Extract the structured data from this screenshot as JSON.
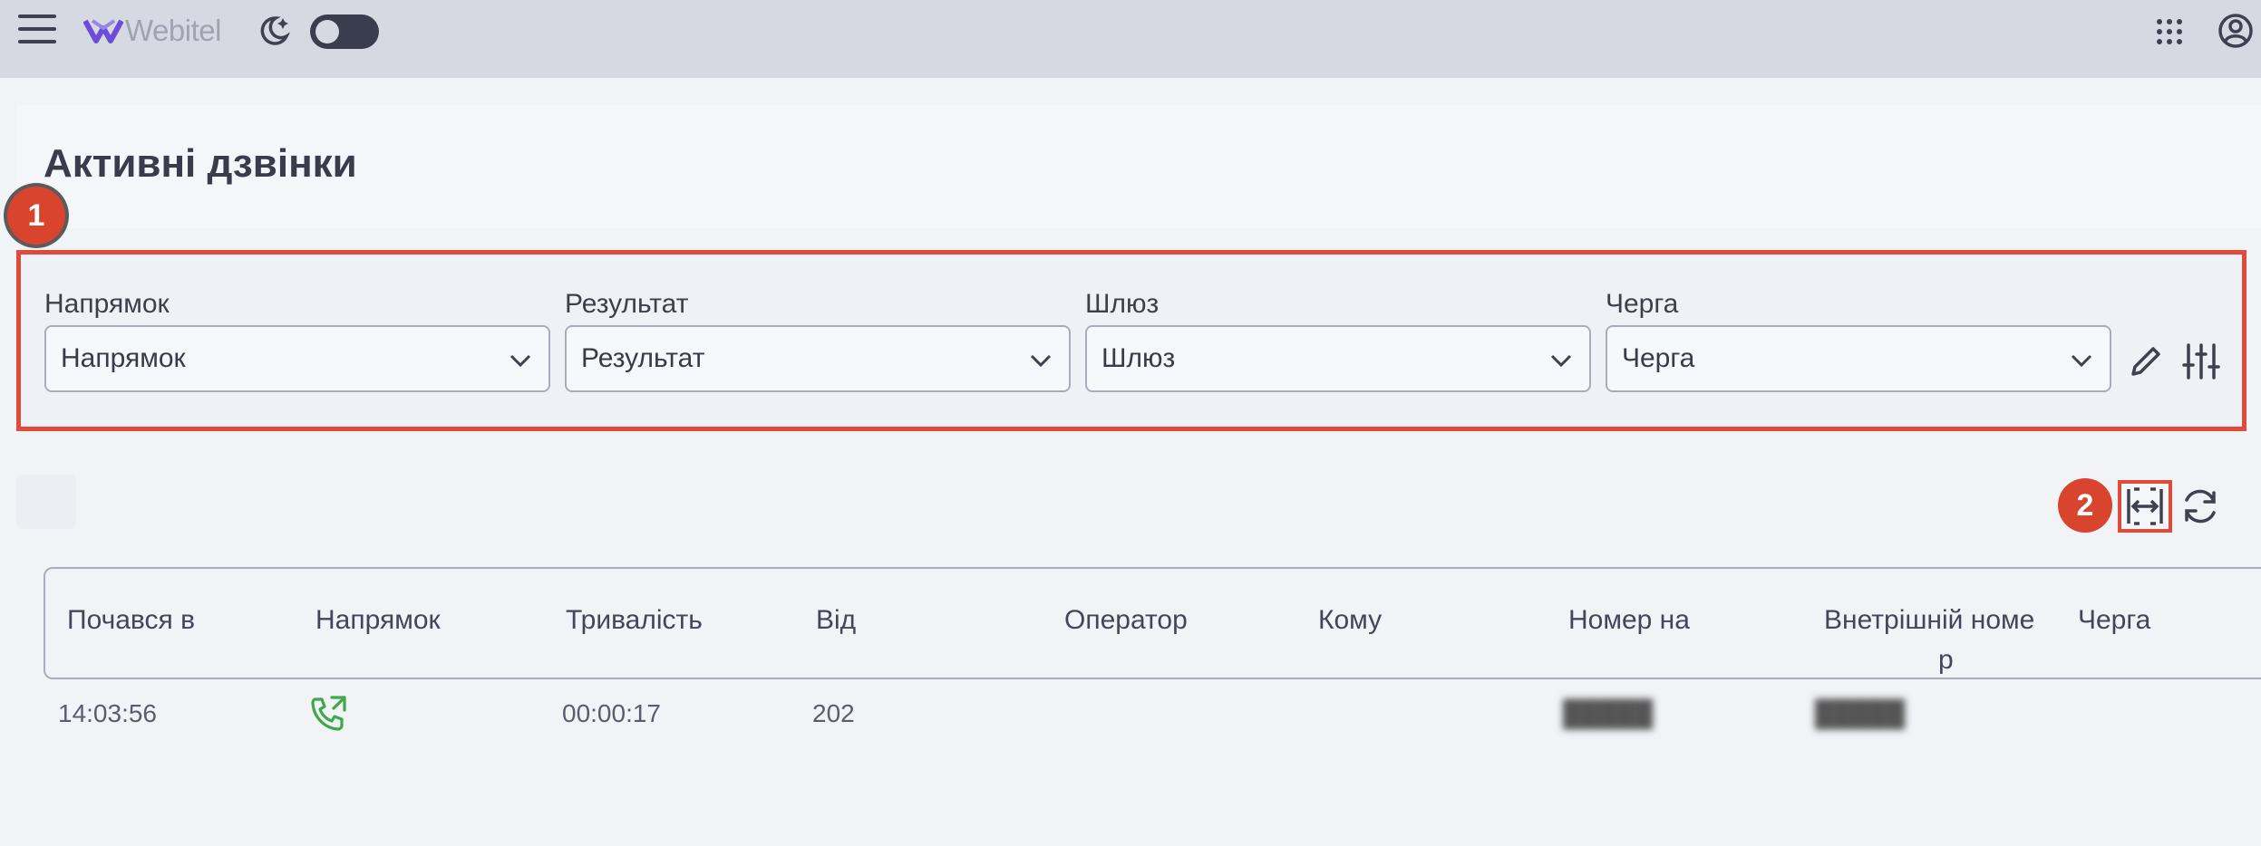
{
  "header": {
    "logo_text": "Webitel",
    "theme_toggle_state": "off"
  },
  "page": {
    "title": "Активні дзвінки"
  },
  "annotations": {
    "badge_1": "1",
    "badge_2": "2"
  },
  "filters": [
    {
      "label": "Напрямок",
      "value": "Напрямок"
    },
    {
      "label": "Результат",
      "value": "Результат"
    },
    {
      "label": "Шлюз",
      "value": "Шлюз"
    },
    {
      "label": "Черга",
      "value": "Черга"
    }
  ],
  "table": {
    "columns": [
      "Почався в",
      "Напрямок",
      "Тривалість",
      "Від",
      "Оператор",
      "Кому",
      "Номер на",
      "Внетрішній номе",
      "р",
      "Черга"
    ],
    "rows": [
      {
        "started": "14:03:56",
        "direction_icon": "outbound-call-icon",
        "duration": "00:00:17",
        "from": "202",
        "operator": "",
        "to": "",
        "number": "█████",
        "internal": "█████",
        "queue": ""
      }
    ]
  },
  "colors": {
    "accent_red": "#e04a3a",
    "brand_purple": "#6c4cd8",
    "call_green": "#3fa94a"
  }
}
